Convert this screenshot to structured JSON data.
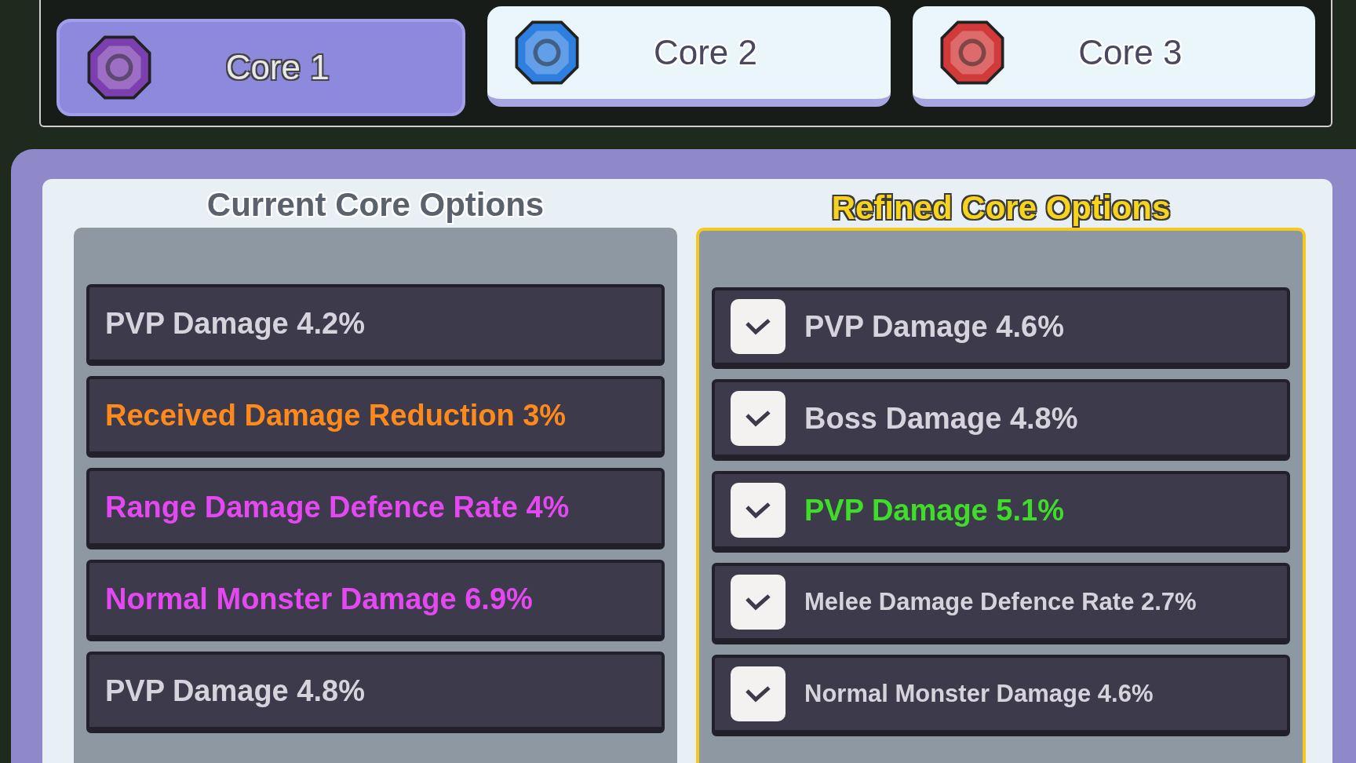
{
  "tabs": [
    {
      "label": "Core 1",
      "selected": true,
      "color": "#7b3fb0"
    },
    {
      "label": "Core 2",
      "selected": false,
      "color": "#2f7fe0"
    },
    {
      "label": "Core 3",
      "selected": false,
      "color": "#d23a3a"
    }
  ],
  "current_options": {
    "title": "Current Core Options",
    "options": [
      {
        "text": "PVP Damage 4.2%",
        "color": "#d6d3dc"
      },
      {
        "text": "Received Damage Reduction 3%",
        "color": "#ff8a1c"
      },
      {
        "text": "Range Damage Defence Rate 4%",
        "color": "#e448f0"
      },
      {
        "text": "Normal Monster Damage 6.9%",
        "color": "#e448f0"
      },
      {
        "text": "PVP Damage 4.8%",
        "color": "#d6d3dc"
      }
    ]
  },
  "refined_options": {
    "title": "Refined Core Options",
    "options": [
      {
        "text": "PVP Damage 4.6%",
        "color": "#d6d3dc",
        "checked": true
      },
      {
        "text": "Boss Damage 4.8%",
        "color": "#d6d3dc",
        "checked": true
      },
      {
        "text": "PVP Damage 5.1%",
        "color": "#3fdc2a",
        "checked": true
      },
      {
        "text": "Melee Damage Defence Rate 2.7%",
        "color": "#d6d3dc",
        "checked": true
      },
      {
        "text": "Normal Monster Damage 4.6%",
        "color": "#d6d3dc",
        "checked": true
      }
    ]
  }
}
